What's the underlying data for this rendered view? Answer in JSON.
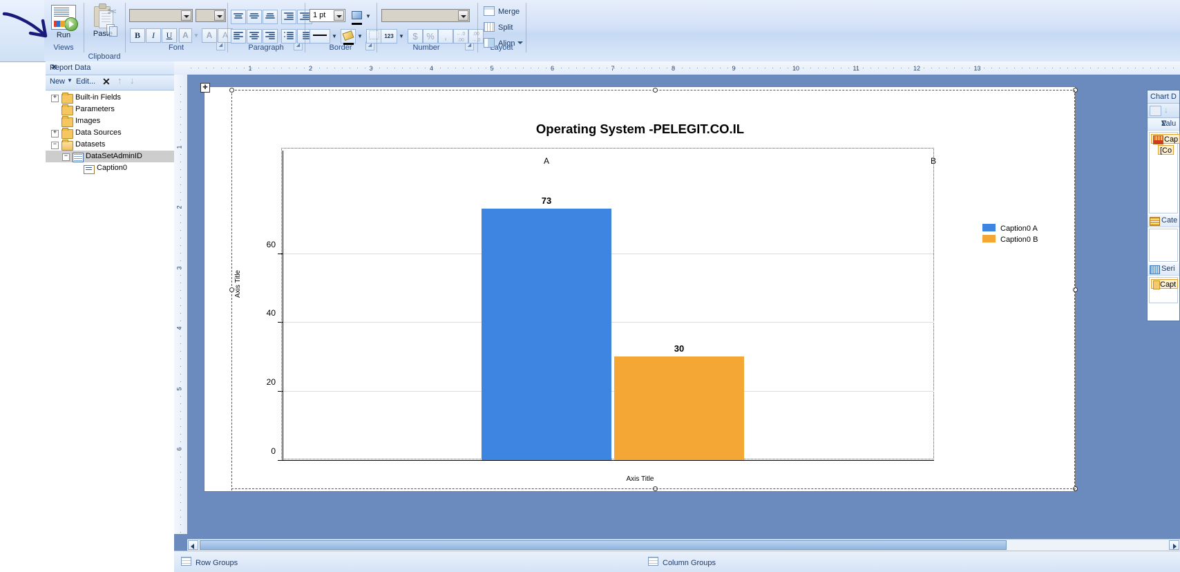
{
  "ribbon": {
    "groups": [
      {
        "name": "views",
        "label": "Views"
      },
      {
        "name": "clipboard",
        "label": "Clipboard"
      },
      {
        "name": "font",
        "label": "Font"
      },
      {
        "name": "paragraph",
        "label": "Paragraph"
      },
      {
        "name": "border",
        "label": "Border"
      },
      {
        "name": "number",
        "label": "Number"
      },
      {
        "name": "layout",
        "label": "Layout"
      }
    ],
    "run_label": "Run",
    "paste_label": "Paste",
    "cut_icon": "scissors-icon",
    "copy_icon": "copy-icon",
    "font_name_value": "",
    "font_size_value": "",
    "bold_label": "B",
    "italic_label": "I",
    "underline_label": "U",
    "font_color_label": "A",
    "grow_font_label": "A",
    "shrink_font_label": "A",
    "border_width_value": "1 pt",
    "number_format_value": "",
    "number_style_label": "123",
    "currency_label": "$",
    "percent_label": "%",
    "comma_label": ",",
    "inc_dec_label": ".00",
    "dec_dec_label": ".00",
    "merge_label": "Merge",
    "split_label": "Split",
    "align_label": "Align"
  },
  "report_data": {
    "title": "Report Data",
    "close_label": "✕",
    "toolbar": {
      "new_label": "New",
      "edit_label": "Edit...",
      "delete_label": "✕",
      "up_label": "↑",
      "down_label": "↓"
    },
    "tree": [
      {
        "label": "Built-in Fields",
        "expander": "+",
        "icon": "folder-icon",
        "depth": 0,
        "selected": false
      },
      {
        "label": "Parameters",
        "expander": "",
        "icon": "folder-icon",
        "depth": 0,
        "selected": false
      },
      {
        "label": "Images",
        "expander": "",
        "icon": "folder-icon",
        "depth": 0,
        "selected": false
      },
      {
        "label": "Data Sources",
        "expander": "+",
        "icon": "folder-icon",
        "depth": 0,
        "selected": false
      },
      {
        "label": "Datasets",
        "expander": "−",
        "icon": "folder-open-icon",
        "depth": 0,
        "selected": false
      },
      {
        "label": "DataSetAdminID",
        "expander": "−",
        "icon": "dataset-icon",
        "depth": 1,
        "selected": true
      },
      {
        "label": "Caption0",
        "expander": "",
        "icon": "field-icon",
        "depth": 2,
        "selected": false
      }
    ]
  },
  "rulers": {
    "h_labels": [
      "1",
      "2",
      "3",
      "4",
      "5",
      "6",
      "7",
      "8",
      "9",
      "10",
      "11",
      "12",
      "13"
    ],
    "v_labels": [
      "1",
      "2",
      "3",
      "4",
      "5",
      "6"
    ]
  },
  "chart_data": {
    "type": "bar",
    "title": "Operating System -PELEGIT.CO.IL",
    "xlabel": "Axis Title",
    "ylabel": "Axis Title",
    "categories": [
      "A",
      "B"
    ],
    "values": [
      73,
      30
    ],
    "data_labels": [
      "73",
      "30"
    ],
    "yticks": [
      0,
      20,
      40,
      60
    ],
    "ylim": [
      0,
      75
    ],
    "grid": true,
    "legend_position": "right",
    "legend": [
      {
        "label": "Caption0 A",
        "color": "#3d85e0"
      },
      {
        "label": "Caption0 B",
        "color": "#f4a734"
      }
    ],
    "series": [
      {
        "name": "Caption0 A",
        "category": "A",
        "value": 73,
        "color": "#3d85e0"
      },
      {
        "name": "Caption0 B",
        "category": "B",
        "value": 30,
        "color": "#f4a734"
      }
    ]
  },
  "chart_panel": {
    "title": "Chart D",
    "values_label": "Valu",
    "values_chip": "Cap",
    "values_chip2": "[Co",
    "category_label": "Cate",
    "series_label": "Seri",
    "series_chip": "Capt"
  },
  "bottom": {
    "row_groups": "Row Groups",
    "column_groups": "Column Groups"
  }
}
